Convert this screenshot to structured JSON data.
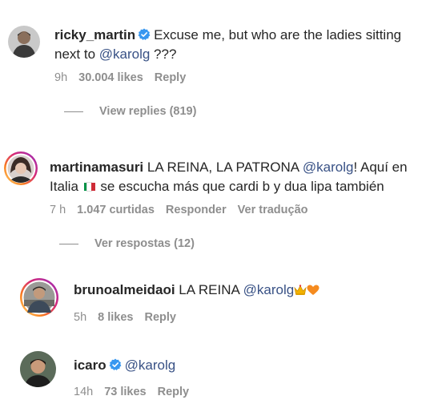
{
  "comments": [
    {
      "username": "ricky_martin",
      "verified": true,
      "text_part1": "Excuse me, but who are the ladies sitting",
      "text_line2_prefix": "next to ",
      "mention": "@karolg",
      "text_suffix": " ???",
      "time": "9h",
      "likes": "30.004 likes",
      "reply": "Reply",
      "view_replies": "View replies (819)"
    },
    {
      "username": "martinamasuri",
      "text_part1": " LA REINA, LA PATRONA ",
      "mention": "@karolg",
      "text_part2": "! Aquí en",
      "line2_prefix": "Italia ",
      "flag_name": "italy-flag-icon",
      "line2_suffix": " se escucha más que cardi b y dua lipa también",
      "time": "7 h",
      "likes": "1.047 curtidas",
      "reply": "Responder",
      "translate": "Ver tradução",
      "view_replies": "Ver respostas (12)"
    },
    {
      "username": "brunoalmeidaoi",
      "text_part1": " LA REINA ",
      "mention": "@karolg",
      "emoji1": "👑",
      "emoji2": "🧡",
      "time": "5h",
      "likes": "8 likes",
      "reply": "Reply"
    },
    {
      "username": "icaro",
      "verified": true,
      "mention": "@karolg",
      "time": "14h",
      "likes": "73 likes",
      "reply": "Reply"
    }
  ],
  "colors": {
    "text": "#262626",
    "meta": "#8e8e8e",
    "mention": "#385185",
    "verified": "#3897f0",
    "story_ring": [
      "#feda75",
      "#fa7e1e",
      "#d62976",
      "#962fbf",
      "#4f5bd5"
    ]
  }
}
